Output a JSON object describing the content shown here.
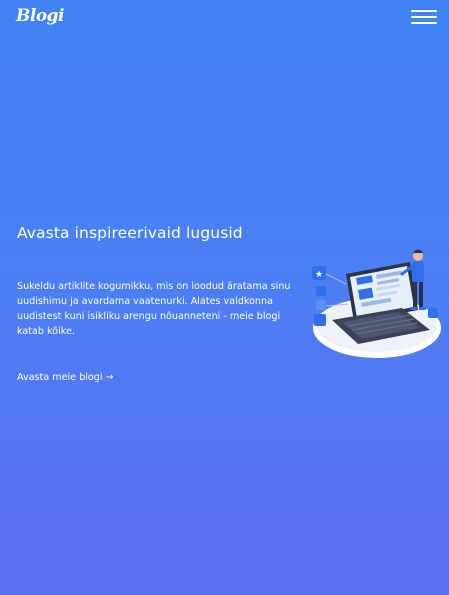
{
  "header": {
    "logo_text": "Blogi",
    "menu_icon": "hamburger-menu-icon"
  },
  "hero": {
    "title": "Avasta inspireerivaid lugusid",
    "description": "Sukeldu artiklite kogumikku, mis on loodud äratama sinu uudishimu ja avardama vaatenurki. Alates valdkonna uudistest kuni isikliku arengu nõuanneteni - meie blogi katab kõike.",
    "cta_label": "Avasta meie blogi →",
    "illustration": "person-with-laptop-illustration"
  },
  "colors": {
    "background_top": "#3f83f5",
    "background_bottom": "#5c6ff0",
    "text": "#ffffff",
    "illustration_accent": "#2f6fe8",
    "illustration_dark": "#2d3348"
  }
}
